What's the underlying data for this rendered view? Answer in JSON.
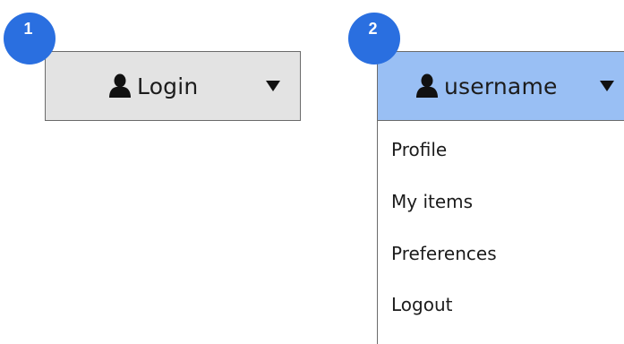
{
  "badges": [
    {
      "number": "1"
    },
    {
      "number": "2"
    }
  ],
  "login_button": {
    "label": "Login",
    "icon": "person-icon",
    "caret": "caret-down-icon",
    "background": "#e3e3e3"
  },
  "user_button": {
    "label": "username",
    "icon": "person-icon",
    "caret": "caret-down-icon",
    "background": "#99bff4"
  },
  "menu": {
    "items": [
      {
        "label": "Profile"
      },
      {
        "label": "My items"
      },
      {
        "label": "Preferences"
      },
      {
        "label": "Logout"
      }
    ]
  },
  "colors": {
    "badge": "#2a6fe0",
    "border": "#6b6b6b",
    "text": "#1c1c1c"
  }
}
